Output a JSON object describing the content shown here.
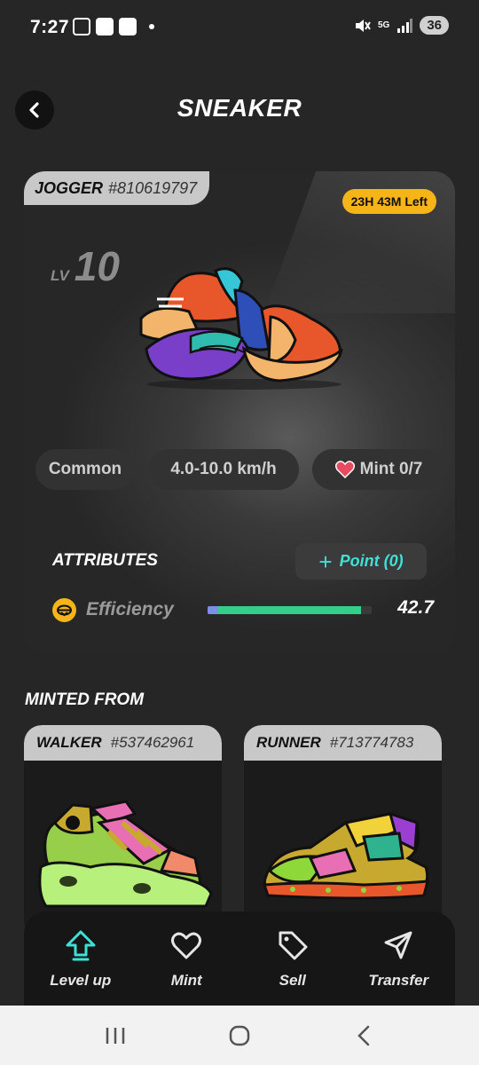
{
  "status_bar": {
    "time": "7:27",
    "network": "5G",
    "battery": "36"
  },
  "header": {
    "title": "SNEAKER"
  },
  "sneaker": {
    "type": "JOGGER",
    "id": "#810619797",
    "timer": "23H 43M Left",
    "level_label": "LV",
    "level": "10",
    "rarity": "Common",
    "speed_range": "4.0-10.0 km/h",
    "mint": "Mint 0/7"
  },
  "attributes": {
    "title": "ATTRIBUTES",
    "point_button": "Point (0)",
    "efficiency_label": "Efficiency",
    "efficiency_value": "42.7",
    "efficiency_fill_fraction": 0.93
  },
  "minted_from": {
    "title": "MINTED FROM",
    "parents": [
      {
        "type": "WALKER",
        "id": "#537462961"
      },
      {
        "type": "RUNNER",
        "id": "#713774783"
      }
    ]
  },
  "actions": [
    {
      "label": "Level up",
      "icon": "level-up-arrow-icon",
      "color": "#3fe0d6"
    },
    {
      "label": "Mint",
      "icon": "heart-icon"
    },
    {
      "label": "Sell",
      "icon": "tag-icon"
    },
    {
      "label": "Transfer",
      "icon": "send-icon"
    }
  ],
  "colors": {
    "accent_cyan": "#3fe0d6",
    "timer_yellow": "#f5b417",
    "bar_green": "#33cf8a",
    "heart_red": "#e84a5f"
  }
}
